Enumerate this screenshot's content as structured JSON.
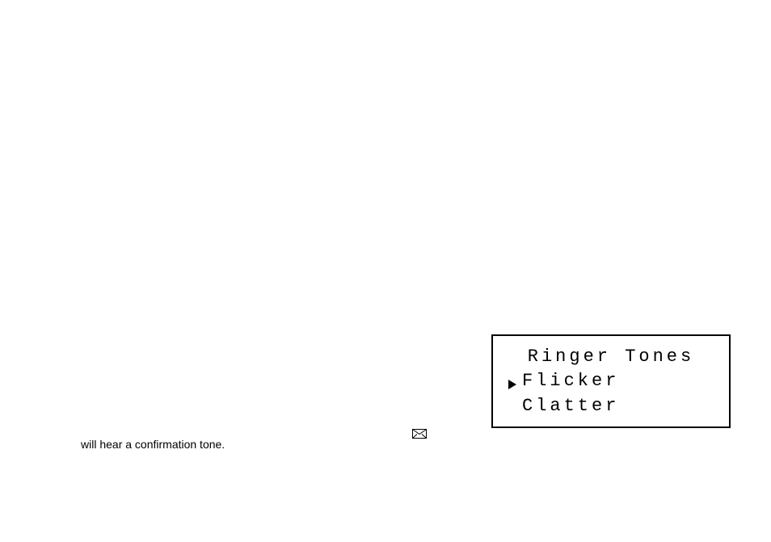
{
  "body_text": "will hear a confirmation tone.",
  "lcd": {
    "title": "Ringer Tones",
    "items": [
      {
        "label": "Flicker",
        "selected": true
      },
      {
        "label": "Clatter",
        "selected": false
      }
    ]
  }
}
